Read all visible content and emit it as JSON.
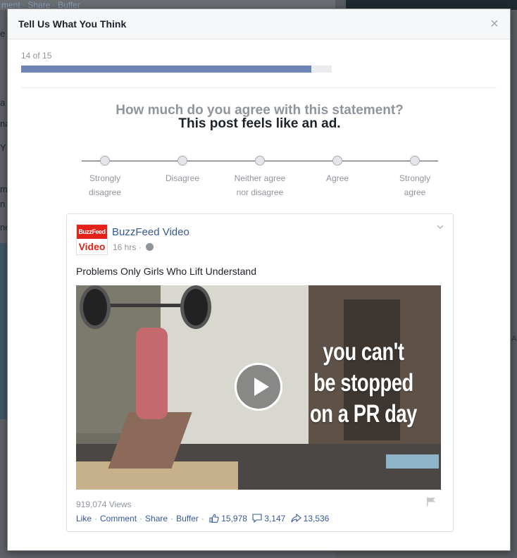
{
  "background": {
    "strip_text": "ment · Share · Buffer",
    "fragments": [
      "e I",
      "a",
      "na",
      "Y",
      "m",
      "n",
      "ne"
    ],
    "right_fragment": "AL"
  },
  "dialog": {
    "title": "Tell Us What You Think",
    "close_icon": "×"
  },
  "progress": {
    "label": "14 of 15",
    "current": 14,
    "total": 15,
    "color": "#6d84b4"
  },
  "question": {
    "prompt": "How much do you agree with this statement?",
    "statement": "This post feels like an ad."
  },
  "scale": {
    "options": [
      {
        "line1": "Strongly",
        "line2": "disagree"
      },
      {
        "line1": "Disagree",
        "line2": ""
      },
      {
        "line1": "Neither agree",
        "line2": "nor disagree"
      },
      {
        "line1": "Agree",
        "line2": ""
      },
      {
        "line1": "Strongly",
        "line2": "agree"
      }
    ]
  },
  "post": {
    "logo_top": "BuzzFeed",
    "logo_bottom": "Video",
    "page_name": "BuzzFeed Video",
    "time": "16 hrs",
    "privacy_icon": "globe-icon",
    "text": "Problems Only Girls Who Lift Understand",
    "video_overlay": [
      "you can't",
      "be stopped",
      "on a PR day"
    ],
    "views": "919,074 Views",
    "actions": {
      "like": "Like",
      "comment": "Comment",
      "share": "Share",
      "buffer": "Buffer"
    },
    "stats": {
      "likes": "15,978",
      "comments": "3,147",
      "shares": "13,536"
    }
  },
  "colors": {
    "link": "#365899",
    "muted": "#90949c",
    "brand_red": "#e32119"
  }
}
